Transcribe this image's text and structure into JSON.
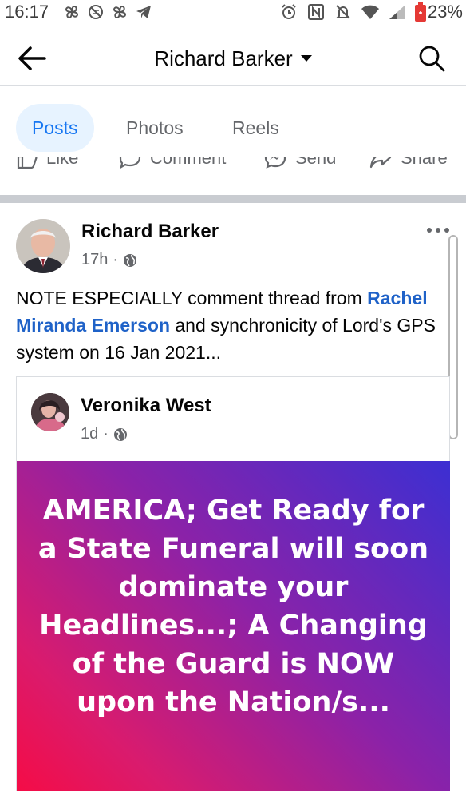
{
  "status_bar": {
    "time": "16:17",
    "battery": "23%",
    "battery_color": "#e53935"
  },
  "header": {
    "title": "Richard Barker"
  },
  "tabs": [
    {
      "label": "Posts",
      "active": true
    },
    {
      "label": "Photos",
      "active": false
    },
    {
      "label": "Reels",
      "active": false
    }
  ],
  "actions": {
    "like": "Like",
    "comment": "Comment",
    "send": "Send",
    "share": "Share"
  },
  "post": {
    "author": "Richard Barker",
    "time": "17h",
    "separator": "·",
    "text_before": "NOTE ESPECIALLY comment thread from ",
    "mention": "Rachel Miranda Emerson",
    "text_after": " and synchronicity of Lord's GPS system on 16 Jan 2021...",
    "shared": {
      "author": "Veronika West",
      "time": "1d",
      "separator": "·",
      "background_text": "AMERICA; Get Ready for a State Funeral will soon dominate your Headlines...; A Changing of the Guard is NOW upon the Nation/s..."
    }
  },
  "colors": {
    "accent": "#1877f2",
    "mention": "#1f62c8",
    "gradient": [
      "#3c2fd2",
      "#8b22a8",
      "#d91b6e",
      "#f50c46"
    ]
  }
}
